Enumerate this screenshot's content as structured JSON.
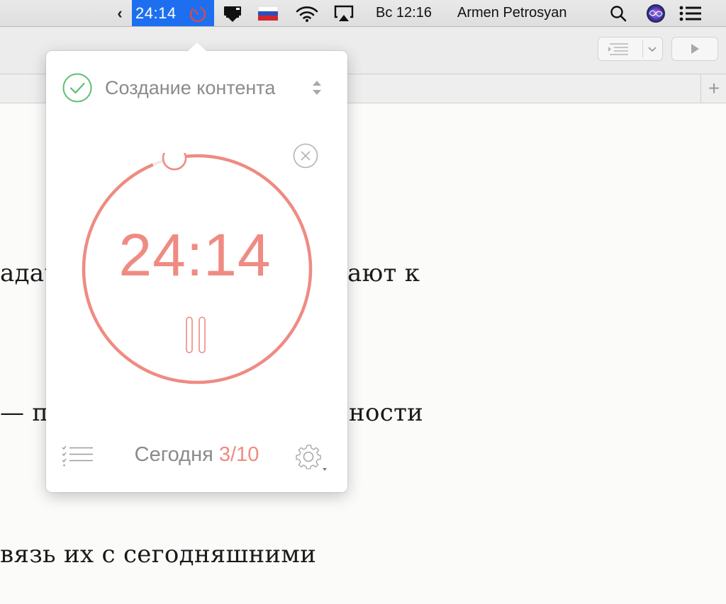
{
  "menubar": {
    "chevron": "‹",
    "timer_text": "24:14",
    "clock": "Вс 12:16",
    "user": "Armen Petrosyan",
    "icons": [
      "chevron-left-icon",
      "pomodoro-timer-icon",
      "screen-mirror-icon",
      "russian-flag-icon",
      "wifi-icon",
      "airplay-icon",
      "search-icon",
      "siri-icon",
      "notification-center-icon"
    ]
  },
  "window": {
    "tab_add_label": "+",
    "document_lines": [
      "адач",
      "ают к",
      "— п",
      "ности",
      "вязь их с сегодняшними"
    ]
  },
  "popover": {
    "task_title": "Создание контента",
    "timer": "24:14",
    "today_label": "Сегодня",
    "today_count": "3/10",
    "progress_fraction": 0.968
  },
  "colors": {
    "accent": "#ef8b82",
    "check_green": "#5cbf6e",
    "menubar_highlight": "#1e6ff0"
  }
}
